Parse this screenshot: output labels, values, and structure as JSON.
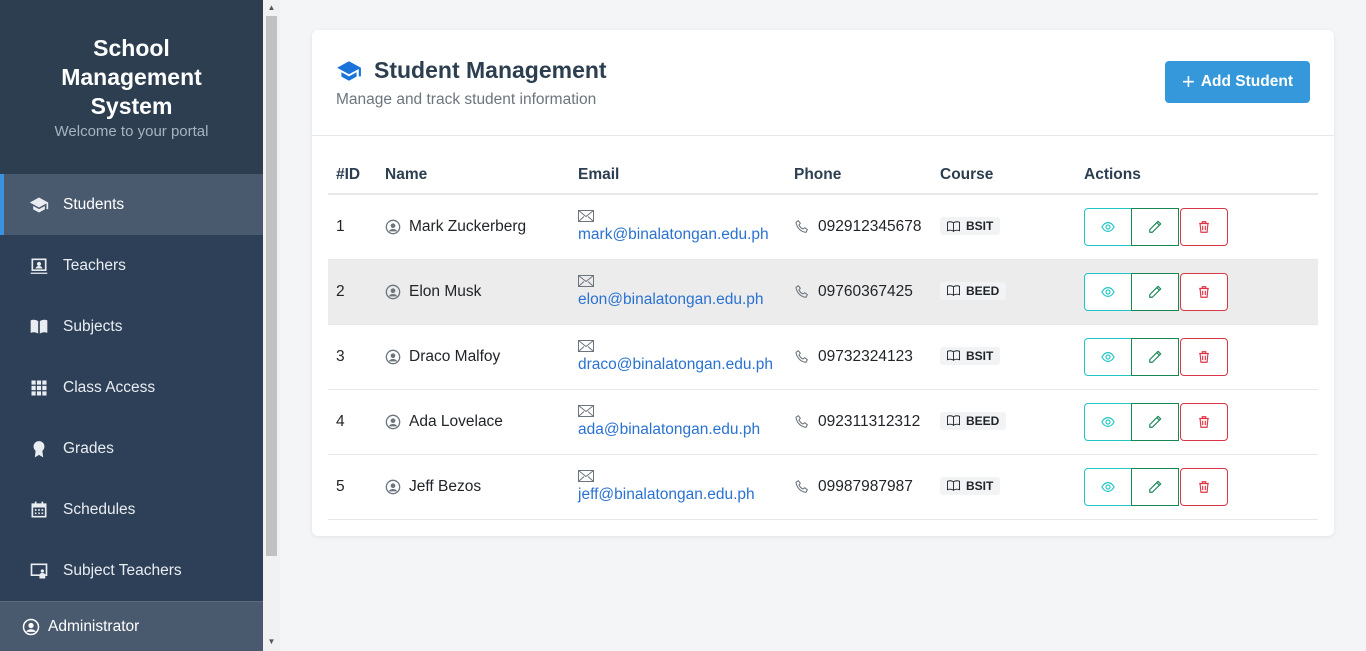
{
  "sidebar": {
    "title_line1": "School",
    "title_line2": "Management",
    "title_line3": "System",
    "subtitle": "Welcome to your portal",
    "items": [
      {
        "label": "Students",
        "icon": "graduation-cap-icon"
      },
      {
        "label": "Teachers",
        "icon": "teacher-board-icon"
      },
      {
        "label": "Subjects",
        "icon": "book-icon"
      },
      {
        "label": "Class Access",
        "icon": "grid-icon"
      },
      {
        "label": "Grades",
        "icon": "award-icon"
      },
      {
        "label": "Schedules",
        "icon": "calendar-icon"
      },
      {
        "label": "Subject Teachers",
        "icon": "person-screen-icon"
      }
    ],
    "user": "Administrator"
  },
  "header": {
    "title": "Student Management",
    "subtitle": "Manage and track student information",
    "add_button": "Add Student"
  },
  "colors": {
    "sidebar_bg": "#2e4057",
    "accent": "#3498db",
    "link": "#2a72d1",
    "view": "#20c5c5",
    "edit": "#198754",
    "delete": "#dc3545"
  },
  "table": {
    "headers": [
      "#ID",
      "Name",
      "Email",
      "Phone",
      "Course",
      "Actions"
    ],
    "rows": [
      {
        "id": "1",
        "name": "Mark Zuckerberg",
        "email": "mark@binalatongan.edu.ph",
        "phone": "092912345678",
        "course": "BSIT"
      },
      {
        "id": "2",
        "name": "Elon Musk",
        "email": "elon@binalatongan.edu.ph",
        "phone": "09760367425",
        "course": "BEED"
      },
      {
        "id": "3",
        "name": "Draco Malfoy",
        "email": "draco@binalatongan.edu.ph",
        "phone": "09732324123",
        "course": "BSIT"
      },
      {
        "id": "4",
        "name": "Ada Lovelace",
        "email": "ada@binalatongan.edu.ph",
        "phone": "092311312312",
        "course": "BEED"
      },
      {
        "id": "5",
        "name": "Jeff Bezos",
        "email": "jeff@binalatongan.edu.ph",
        "phone": "09987987987",
        "course": "BSIT"
      }
    ]
  }
}
